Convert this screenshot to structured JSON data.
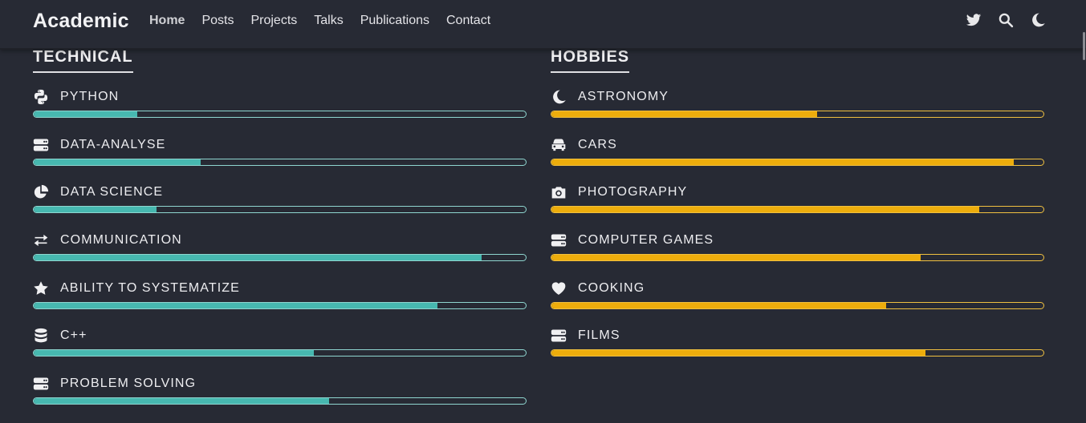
{
  "nav": {
    "brand": "Academic",
    "links": [
      {
        "label": "Home",
        "active": true
      },
      {
        "label": "Posts"
      },
      {
        "label": "Projects"
      },
      {
        "label": "Talks"
      },
      {
        "label": "Publications"
      },
      {
        "label": "Contact"
      }
    ],
    "icons": [
      "twitter-icon",
      "search-icon",
      "moon-icon"
    ]
  },
  "colors": {
    "background": "#272a34",
    "technical_bar": "#47b8b0",
    "technical_border": "#8fd6d0",
    "hobby_bar": "#edad0c",
    "hobby_border": "#f0c040"
  },
  "technical": {
    "title": "TECHNICAL",
    "skills": [
      {
        "name": "PYTHON",
        "icon": "python-icon",
        "level": 0.21
      },
      {
        "name": "DATA-ANALYSE",
        "icon": "server-icon",
        "level": 0.34
      },
      {
        "name": "DATA SCIENCE",
        "icon": "pie-chart-icon",
        "level": 0.25
      },
      {
        "name": "COMMUNICATION",
        "icon": "exchange-arrows-icon",
        "level": 0.91
      },
      {
        "name": "ABILITY TO SYSTEMATIZE",
        "icon": "star-icon",
        "level": 0.82
      },
      {
        "name": "C++",
        "icon": "database-icon",
        "level": 0.57
      },
      {
        "name": "PROBLEM SOLVING",
        "icon": "server-icon",
        "level": 0.6
      }
    ]
  },
  "hobbies": {
    "title": "HOBBIES",
    "skills": [
      {
        "name": "ASTRONOMY",
        "icon": "moon-icon",
        "level": 0.54
      },
      {
        "name": "CARS",
        "icon": "car-icon",
        "level": 0.94
      },
      {
        "name": "PHOTOGRAPHY",
        "icon": "camera-icon",
        "level": 0.87
      },
      {
        "name": "COMPUTER GAMES",
        "icon": "server-icon",
        "level": 0.75
      },
      {
        "name": "COOKING",
        "icon": "heart-icon",
        "level": 0.68
      },
      {
        "name": "FILMS",
        "icon": "server-icon",
        "level": 0.76
      }
    ]
  }
}
